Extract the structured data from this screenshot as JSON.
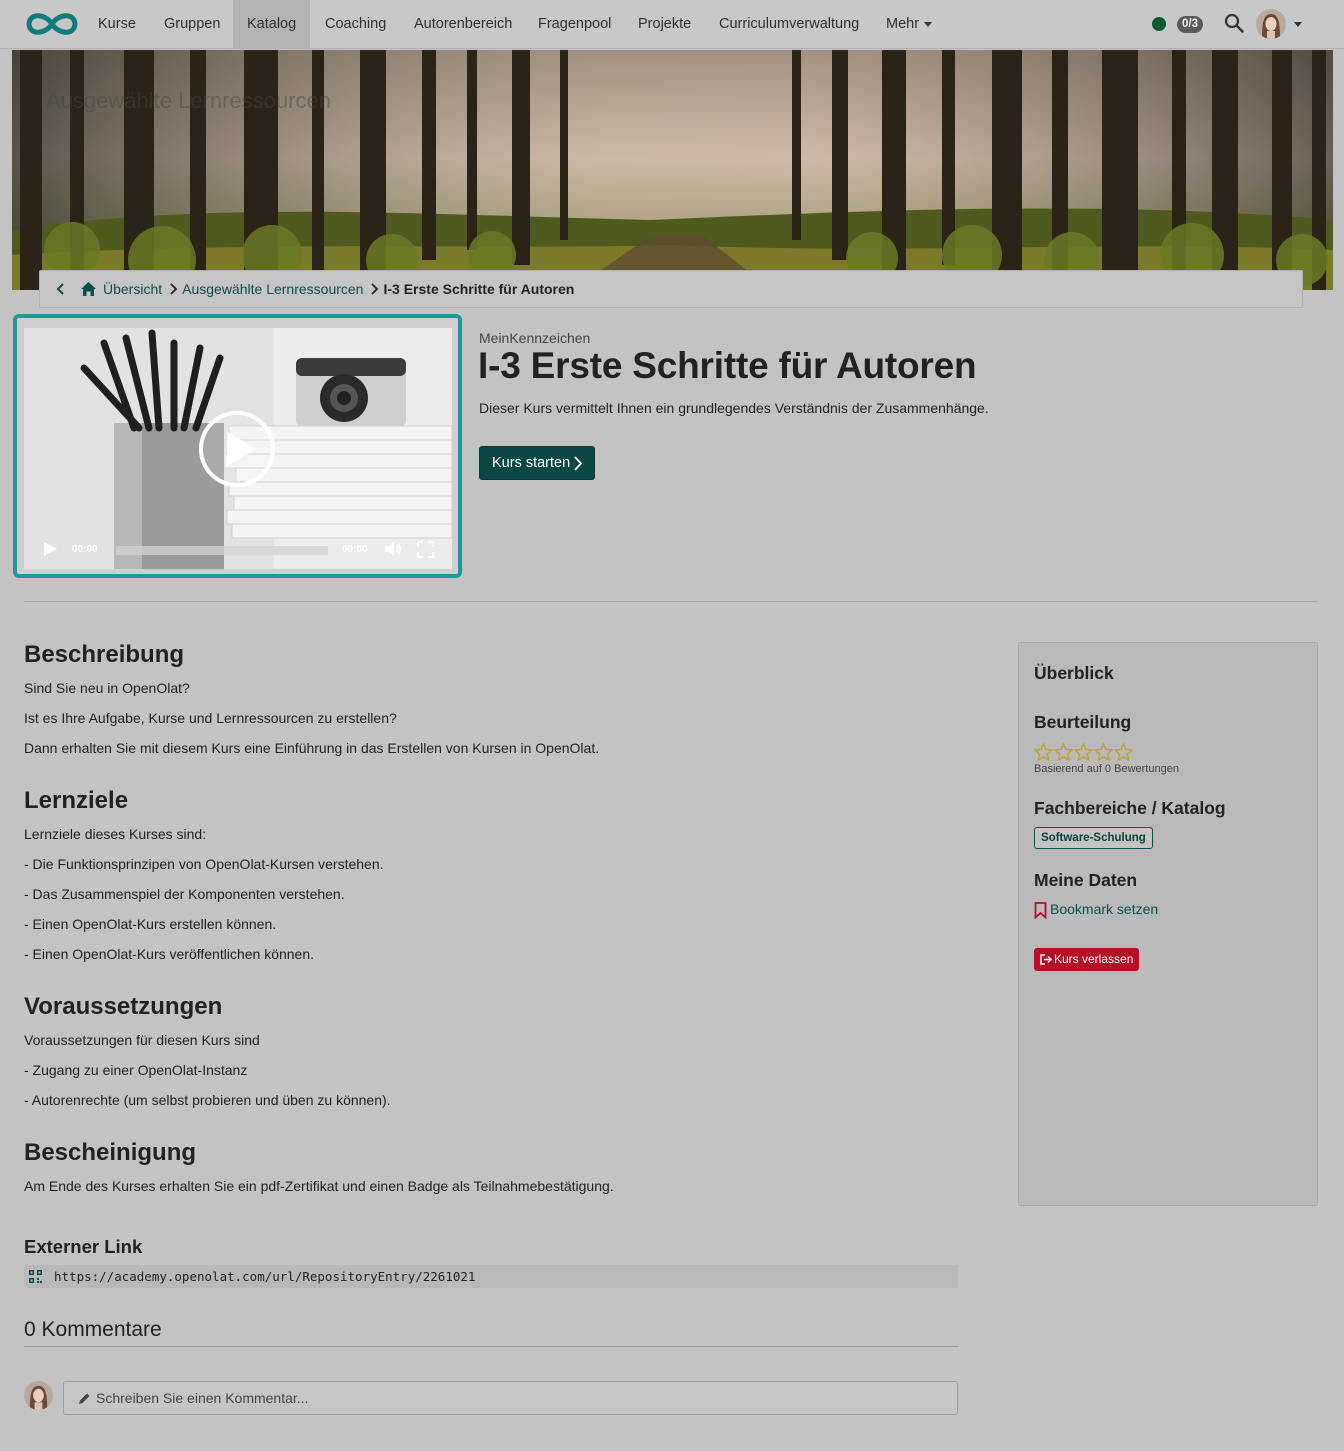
{
  "nav": {
    "items": [
      {
        "label": "Kurse"
      },
      {
        "label": "Gruppen"
      },
      {
        "label": "Katalog"
      },
      {
        "label": "Coaching"
      },
      {
        "label": "Autorenbereich"
      },
      {
        "label": "Fragenpool"
      },
      {
        "label": "Projekte"
      },
      {
        "label": "Curriculumverwaltung"
      },
      {
        "label": "Mehr"
      }
    ],
    "active_index": 2,
    "badge": "0/3",
    "accent_color": "#0f7b7b"
  },
  "banner": {
    "title": "Ausgewählte Lernressourcen"
  },
  "breadcrumb": {
    "home": "Übersicht",
    "parent": "Ausgewählte Lernressourcen",
    "current": "I-3 Erste Schritte für Autoren"
  },
  "video": {
    "time_current": "00:00",
    "time_total": "00:00",
    "progress": 0
  },
  "course": {
    "subtitle": "MeinKennzeichen",
    "title": "I-3 Erste Schritte für Autoren",
    "teaser": "Dieser Kurs vermittelt Ihnen ein grundlegendes Verständnis der Zusammenhänge.",
    "start_label": "Kurs starten"
  },
  "description": {
    "heading": "Beschreibung",
    "lines": [
      "Sind Sie neu in OpenOlat?",
      "Ist es Ihre Aufgabe, Kurse und Lernressourcen zu erstellen?",
      "Dann erhalten Sie mit diesem Kurs eine Einführung in das Erstellen von Kursen in OpenOlat."
    ]
  },
  "objectives": {
    "heading": "Lernziele",
    "lines": [
      "Lernziele dieses Kurses sind:",
      "- Die Funktionsprinzipen von OpenOlat-Kursen verstehen.",
      "- Das Zusammenspiel der Komponenten verstehen.",
      "- Einen OpenOlat-Kurs erstellen können.",
      "- Einen OpenOlat-Kurs veröffentlichen können."
    ]
  },
  "requirements": {
    "heading": "Voraussetzungen",
    "lines": [
      "Voraussetzungen für diesen Kurs sind",
      "- Zugang zu einer OpenOlat-Instanz",
      "- Autorenrechte (um selbst probieren und üben zu können)."
    ]
  },
  "certificate": {
    "heading": "Bescheinigung",
    "lines": [
      "Am Ende des Kurses erhalten Sie ein pdf-Zertifikat und einen Badge als Teilnahmebestätigung."
    ]
  },
  "external_link": {
    "heading": "Externer Link",
    "url": "https://academy.openolat.com/url/RepositoryEntry/2261021"
  },
  "comments": {
    "title": "0 Kommentare",
    "placeholder": "Schreiben Sie einen Kommentar..."
  },
  "overview": {
    "title": "Überblick",
    "rating_heading": "Beurteilung",
    "rating_value": 0,
    "rating_max": 5,
    "rating_note": "Basierend auf 0 Bewertungen",
    "catalog_heading": "Fachbereiche / Katalog",
    "catalog_tag": "Software-Schulung",
    "mydata_heading": "Meine Daten",
    "bookmark_label": "Bookmark setzen",
    "leave_label": "Kurs verlassen",
    "leave_color": "#b51025"
  }
}
